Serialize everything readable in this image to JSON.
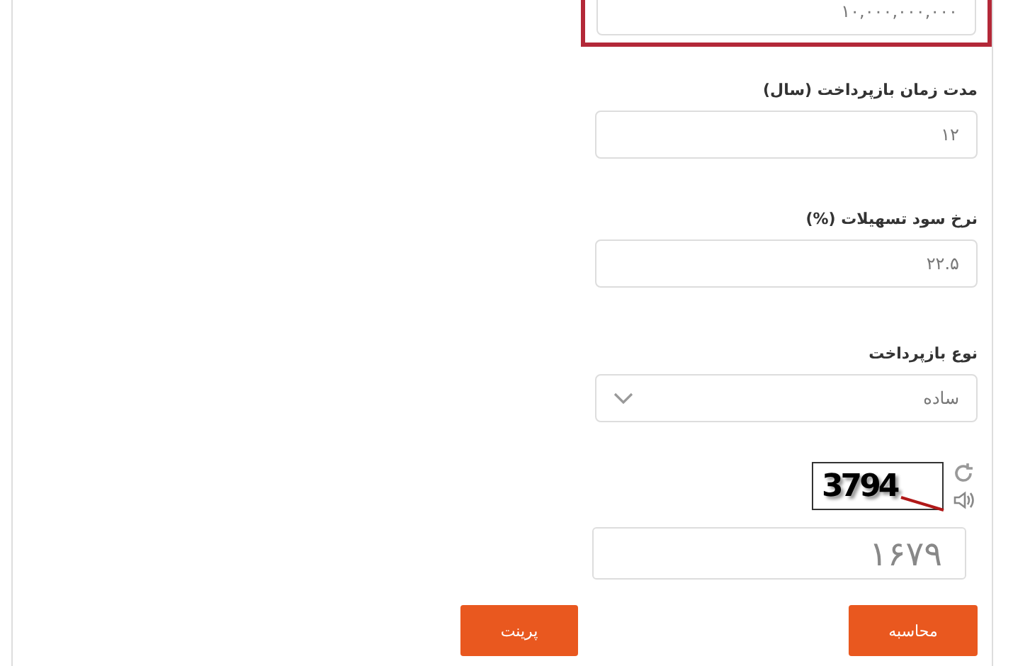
{
  "fields": [
    {
      "kind": "input",
      "value": "۱۰,۰۰۰,۰۰۰,۰۰۰",
      "highlighted": true
    },
    {
      "kind": "input",
      "label": "مدت زمان بازپرداخت (سال)",
      "value": "۱۲",
      "highlighted": false
    },
    {
      "kind": "input",
      "label": "نرخ سود تسهیلات (%)",
      "value": "۲۲.۵",
      "highlighted": false
    },
    {
      "kind": "select",
      "label": "نوع بازپرداخت",
      "value": "ساده",
      "highlighted": false
    }
  ],
  "captcha": {
    "code": "3794",
    "answer": "۱۶۷۹"
  },
  "buttons": [
    {
      "label": "محاسبه"
    },
    {
      "label": "پرینت"
    }
  ]
}
